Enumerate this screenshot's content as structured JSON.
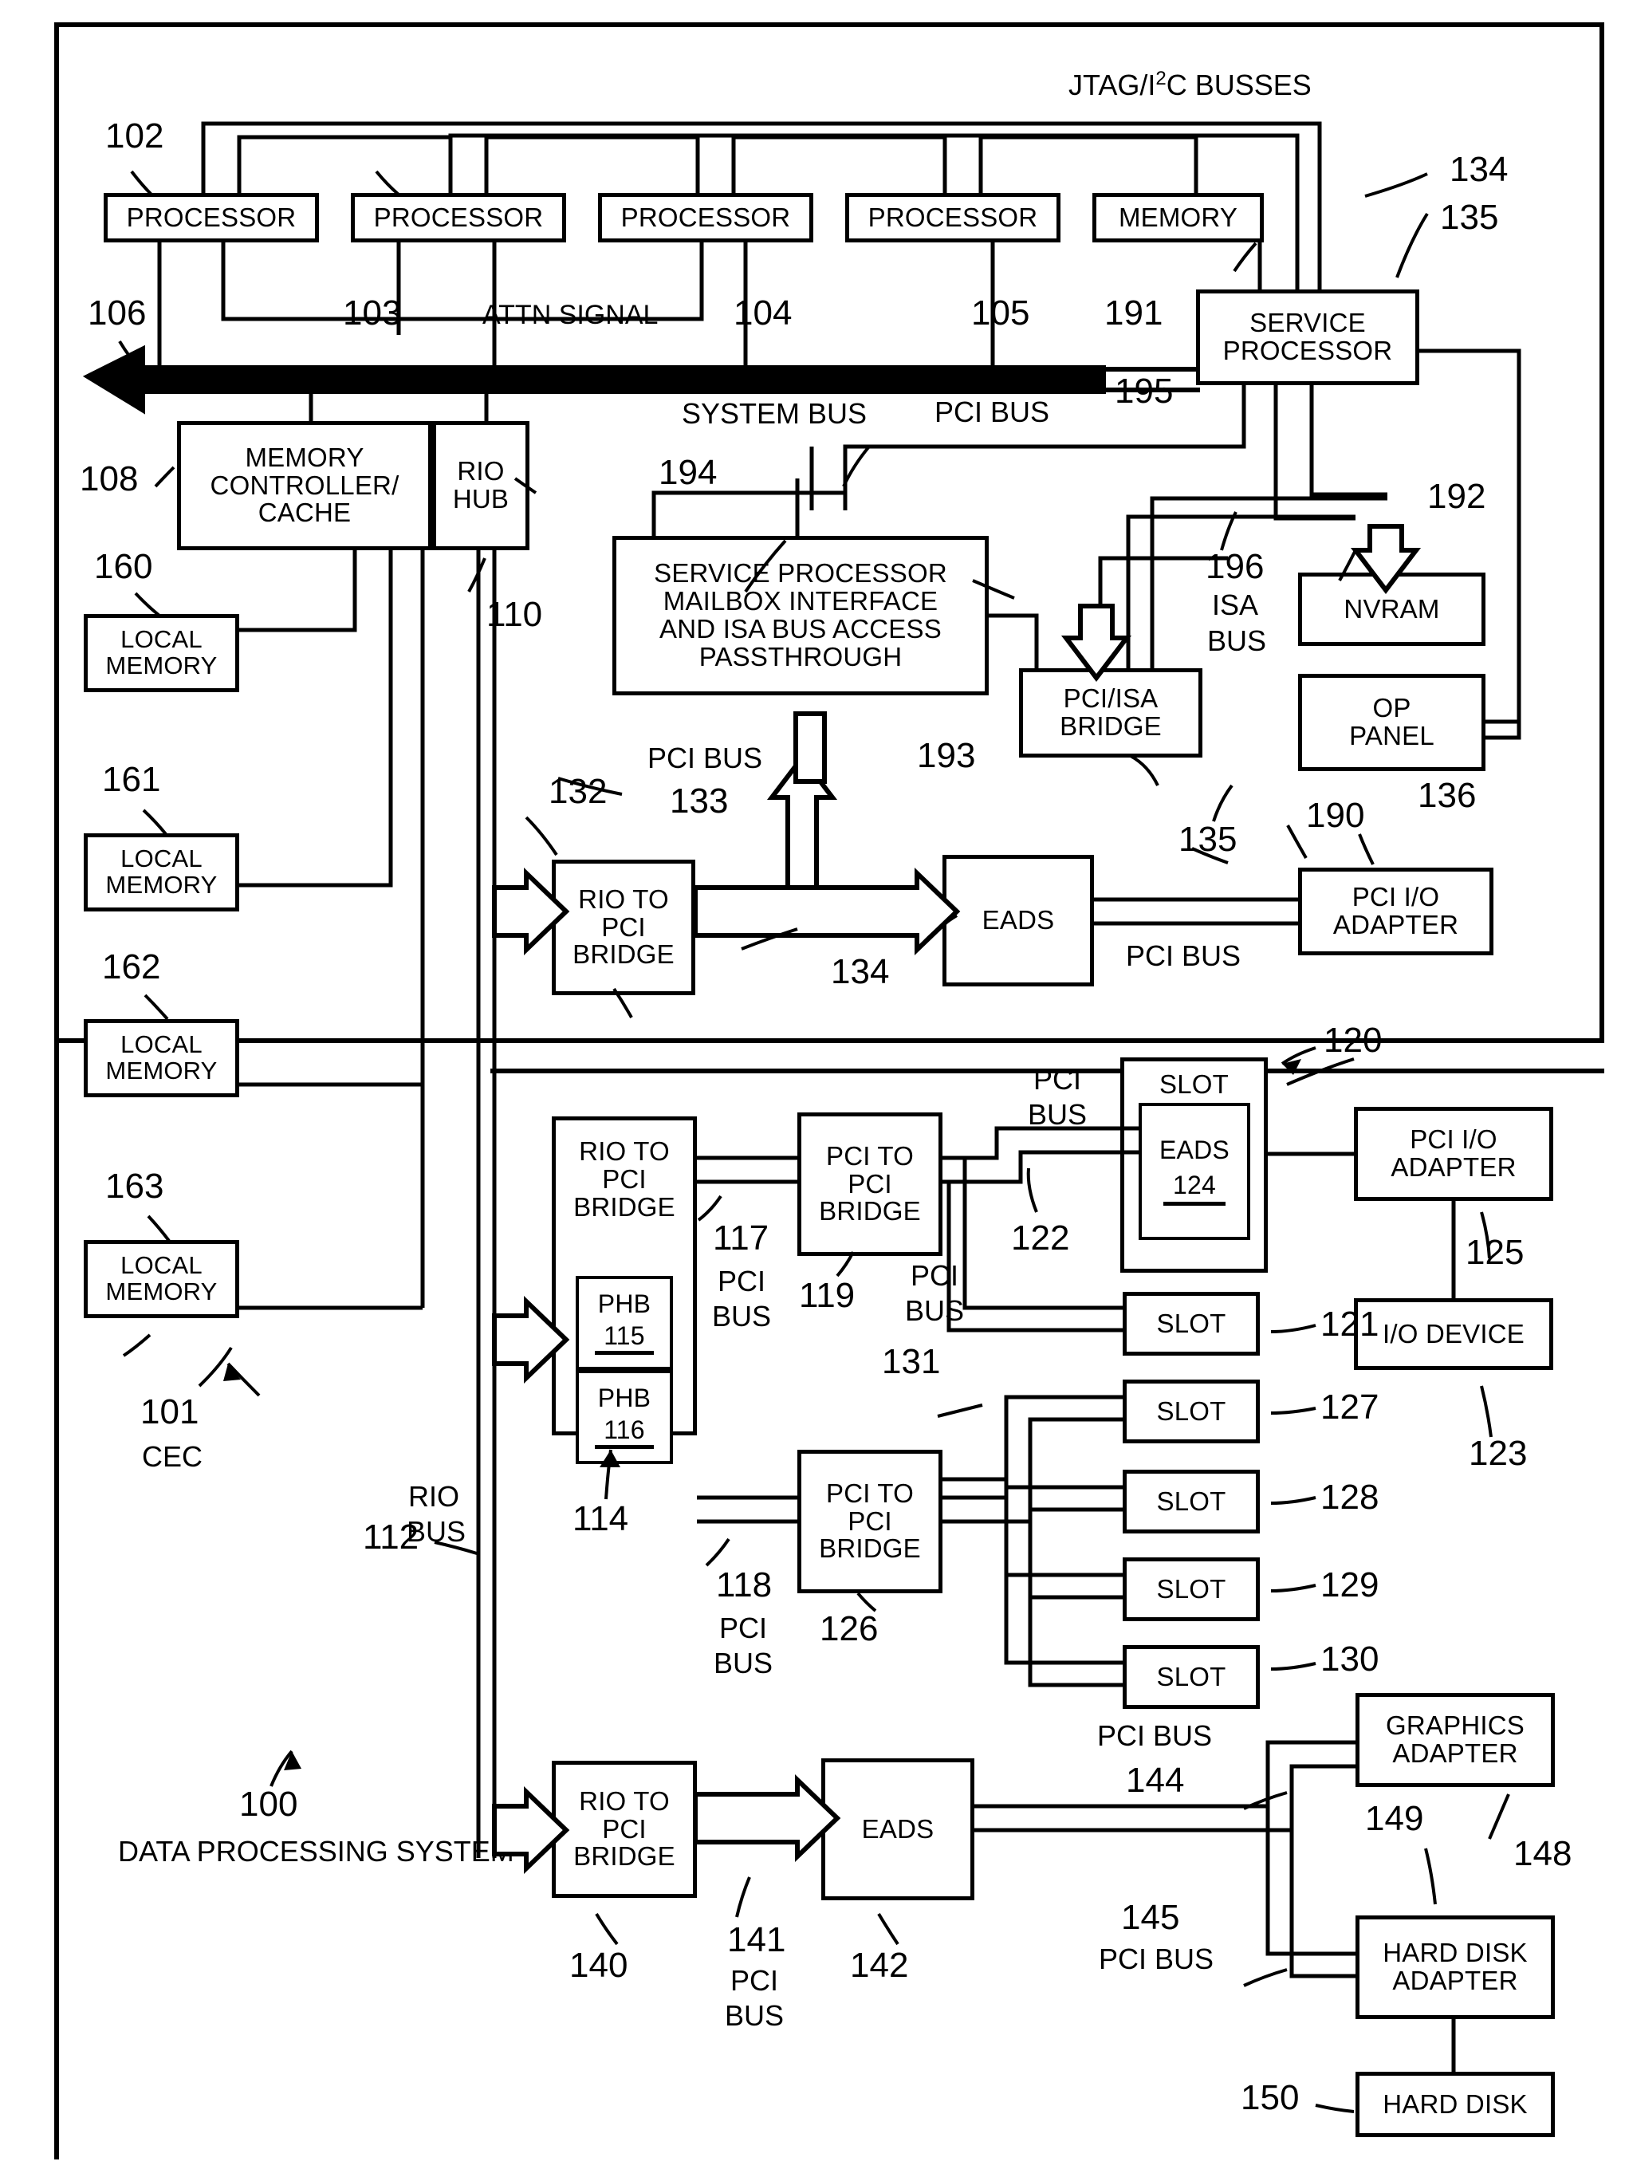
{
  "figure": {
    "title_label": "DATA PROCESSING SYSTEM",
    "title_ref": "100",
    "cec_label": "CEC",
    "cec_ref": "101"
  },
  "bus_labels": {
    "jtag": "JTAG/I",
    "jtag_sup": "2",
    "jtag_tail": "C BUSSES",
    "attn_signal": "ATTN SIGNAL",
    "system_bus": "SYSTEM BUS",
    "pci_bus": "PCI BUS",
    "isa_bus_1": "ISA",
    "isa_bus_2": "BUS",
    "rio_bus_1": "RIO",
    "rio_bus_2": "BUS"
  },
  "blocks": {
    "processor": "PROCESSOR",
    "memory": "MEMORY",
    "service_processor_l1": "SERVICE",
    "service_processor_l2": "PROCESSOR",
    "memory_controller_l1": "MEMORY",
    "memory_controller_l2": "CONTROLLER/",
    "memory_controller_l3": "CACHE",
    "rio_hub_l1": "RIO",
    "rio_hub_l2": "HUB",
    "local_memory_l1": "LOCAL",
    "local_memory_l2": "MEMORY",
    "sp_mailbox_l1": "SERVICE PROCESSOR",
    "sp_mailbox_l2": "MAILBOX INTERFACE",
    "sp_mailbox_l3": "AND ISA BUS ACCESS",
    "sp_mailbox_l4": "PASSTHROUGH",
    "pci_isa_bridge_l1": "PCI/ISA",
    "pci_isa_bridge_l2": "BRIDGE",
    "nvram": "NVRAM",
    "op_panel_l1": "OP",
    "op_panel_l2": "PANEL",
    "rio_to_pci_l1": "RIO TO",
    "rio_to_pci_l2": "PCI",
    "rio_to_pci_l3": "BRIDGE",
    "eads": "EADS",
    "pci_io_adapter_l1": "PCI I/O",
    "pci_io_adapter_l2": "ADAPTER",
    "pci_to_pci_l1": "PCI TO",
    "pci_to_pci_l2": "PCI",
    "pci_to_pci_l3": "BRIDGE",
    "phb": "PHB",
    "slot": "SLOT",
    "io_device": "I/O DEVICE",
    "graphics_adapter_l1": "GRAPHICS",
    "graphics_adapter_l2": "ADAPTER",
    "hard_disk_adapter_l1": "HARD DISK",
    "hard_disk_adapter_l2": "ADAPTER",
    "hard_disk": "HARD DISK"
  },
  "refs": {
    "r100": "100",
    "r101": "101",
    "r102": "102",
    "r103": "103",
    "r104": "104",
    "r105": "105",
    "r106": "106",
    "r108": "108",
    "r110": "110",
    "r112": "112",
    "r114": "114",
    "r115": "115",
    "r116": "116",
    "r117": "117",
    "r118": "118",
    "r119": "119",
    "r120": "120",
    "r121": "121",
    "r122": "122",
    "r123": "123",
    "r124": "124",
    "r125": "125",
    "r126": "126",
    "r127": "127",
    "r128": "128",
    "r129": "129",
    "r130": "130",
    "r131": "131",
    "r132": "132",
    "r133": "133",
    "r134": "134",
    "r134b": "134",
    "r135": "135",
    "r135b": "135",
    "r136": "136",
    "r140": "140",
    "r141": "141",
    "r142": "142",
    "r144": "144",
    "r145": "145",
    "r148": "148",
    "r149": "149",
    "r150": "150",
    "r160": "160",
    "r161": "161",
    "r162": "162",
    "r163": "163",
    "r190": "190",
    "r191": "191",
    "r192": "192",
    "r193": "193",
    "r194": "194",
    "r195": "195",
    "r196": "196"
  },
  "ref_text": {
    "pci_bus_117": "PCI\nBUS",
    "pci_bus_118": "PCI\nBUS",
    "pci_bus_119": "PCI\nBUS",
    "pci_bus_141": "PCI\nBUS",
    "pci_bus_145": "PCI BUS"
  },
  "colors": {
    "ink": "#000000",
    "paper": "#ffffff"
  }
}
